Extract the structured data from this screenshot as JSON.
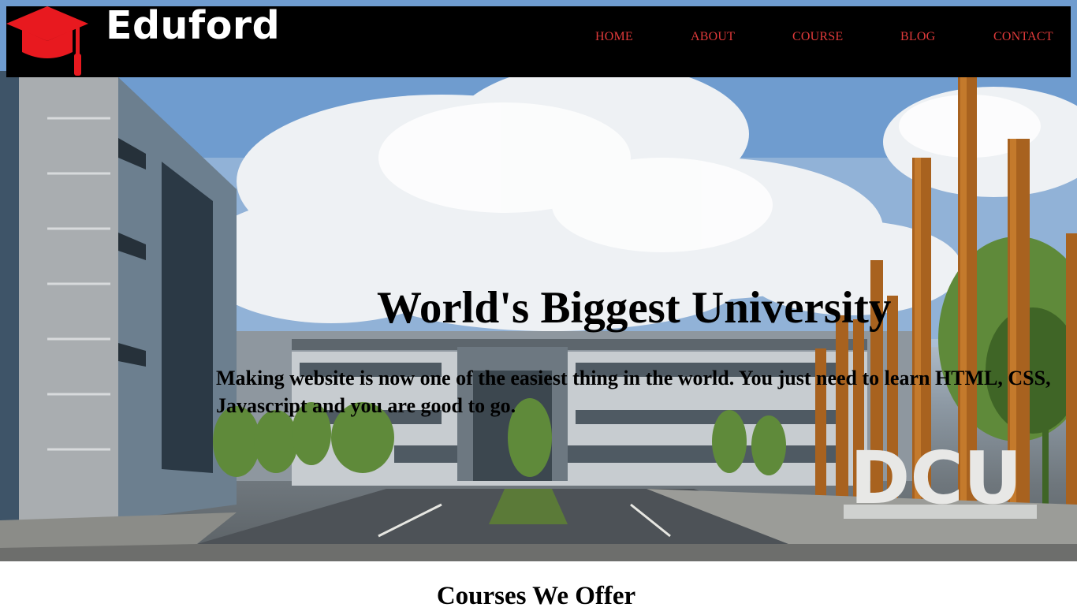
{
  "brand": {
    "name": "Eduford",
    "accent_color": "#e8191f",
    "logo_icon": "graduation-cap-icon"
  },
  "nav": {
    "items": [
      {
        "label": "HOME"
      },
      {
        "label": "ABOUT"
      },
      {
        "label": "COURSE"
      },
      {
        "label": "BLOG"
      },
      {
        "label": "CONTACT"
      }
    ],
    "link_color": "#e03a3a",
    "background": "#000000"
  },
  "hero": {
    "title": "World's Biggest University",
    "text": "Making website is now one of the easiest thing in the world. You just need to learn HTML, CSS, Javascript and you are good to go.",
    "sign": "DCU"
  },
  "courses": {
    "heading": "Courses We Offer"
  }
}
